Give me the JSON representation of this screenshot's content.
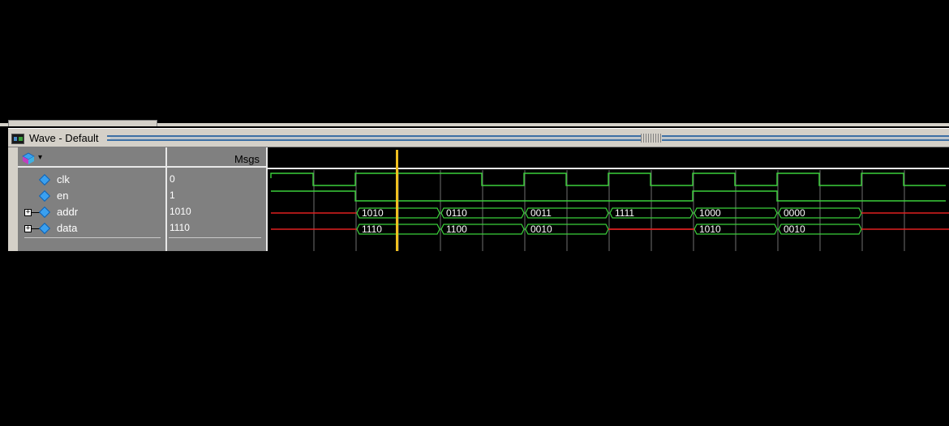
{
  "window": {
    "title": "Wave - Default",
    "values_header": "Msgs"
  },
  "signals": [
    {
      "name": "clk",
      "value": "0",
      "expandable": false
    },
    {
      "name": "en",
      "value": "1",
      "expandable": false
    },
    {
      "name": "addr",
      "value": "1010",
      "expandable": true
    },
    {
      "name": "data",
      "value": "1110",
      "expandable": true
    }
  ],
  "waveform": {
    "clk_levels": [
      1,
      0,
      1,
      1,
      1,
      0,
      1,
      0,
      1,
      0,
      1,
      0,
      1,
      0,
      1,
      0
    ],
    "en_levels": [
      1,
      1,
      0,
      0,
      0,
      0,
      0,
      0,
      0,
      0,
      1,
      1,
      0,
      0,
      0,
      0
    ],
    "addr_values": [
      "1010",
      "0110",
      "0011",
      "1111",
      "1000",
      "0000"
    ],
    "data_values": [
      "1110",
      "1100",
      "0010",
      "1010",
      "0010"
    ],
    "cursor_color": "#f0c020",
    "wave_color": "#3ad03a",
    "undefined_color": "#e02020",
    "grid_color": "#707070"
  }
}
